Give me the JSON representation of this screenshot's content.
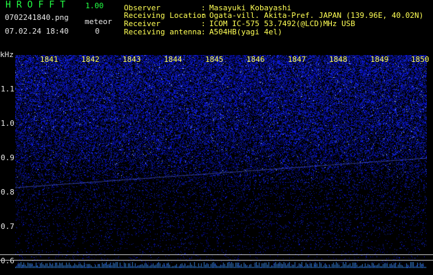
{
  "app": {
    "title": "HROFFT",
    "version": "1.00"
  },
  "file": {
    "name": "0702241840.png",
    "datetime": "07.02.24 18:40"
  },
  "meteor": {
    "label": "meteor",
    "count": "0"
  },
  "info": [
    {
      "label": "Observer",
      "value": "Masayuki Kobayashi"
    },
    {
      "label": "Receiving Location",
      "value": "Ogata-vill. Akita-Pref. JAPAN (139.96E, 40.02N)"
    },
    {
      "label": "Receiver",
      "value": "ICOM IC-575 53.7492(@LCD)MHz USB"
    },
    {
      "label": "Receiving antenna",
      "value": "A504HB(yagi 4el)"
    }
  ],
  "y_axis": {
    "unit": "kHz",
    "ticks": [
      "1.1",
      "1.0",
      "0.9",
      "0.8",
      "0.7",
      "0.6"
    ]
  },
  "time_labels": [
    "1841",
    "1842",
    "1843",
    "1844",
    "1845",
    "1846",
    "1847",
    "1848",
    "1849",
    "1850"
  ],
  "colors": {
    "text_green": "#22ff44",
    "time_label": "#ffff55",
    "noise_blue": "#2a3cff",
    "background": "#000000"
  }
}
